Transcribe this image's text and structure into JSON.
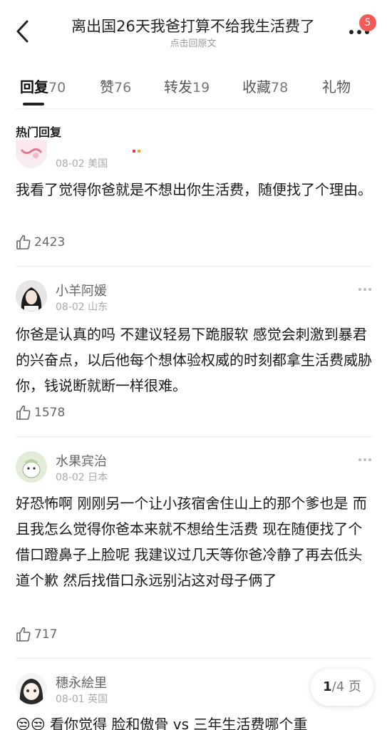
{
  "header": {
    "title": "离出国26天我爸打算不给我生活费了",
    "subtitle": "点击回原文",
    "badge_count": "5"
  },
  "tabs": [
    {
      "label": "回复",
      "count": "70",
      "active": true
    },
    {
      "label": "赞",
      "count": "76",
      "active": false
    },
    {
      "label": "转发",
      "count": "19",
      "active": false
    },
    {
      "label": "收藏",
      "count": "78",
      "active": false
    },
    {
      "label": "礼物",
      "count": "",
      "active": false
    }
  ],
  "section_title": "热门回复",
  "comments": [
    {
      "username": "",
      "date": "08-02",
      "location": "美国",
      "text": "我看了觉得你爸就是不想出你生活费，随便找了个理由。",
      "likes": "2423",
      "avatar": "sticker-avatar"
    },
    {
      "username": "小羊阿媛",
      "date": "08-02",
      "location": "山东",
      "text": "你爸是认真的吗 不建议轻易下跪服软 感觉会刺激到暴君的兴奋点，以后他每个想体验权威的时刻都拿生活费威胁你，钱说断就断一样很难。",
      "likes": "1578",
      "avatar": "girl-photo-avatar"
    },
    {
      "username": "水果宾治",
      "date": "08-02",
      "location": "日本",
      "text": "好恐怖啊 刚刚另一个让小孩宿舍住山上的那个爹也是 而且我怎么觉得你爸本来就不想给生活费 现在随便找了个借口蹬鼻子上脸呢 我建议过几天等你爸冷静了再去低头道个歉 然后找借口永远别沾这对母子俩了",
      "likes": "717",
      "avatar": "cartoon-avatar"
    },
    {
      "username": "穗永絵里",
      "date": "08-01",
      "location": "英国",
      "text": "😒😒 看你觉得 脸和傲骨 vs 三年生活费哪个重",
      "likes": "",
      "avatar": "anime-avatar"
    }
  ],
  "pager": {
    "current": "1",
    "total": "/4",
    "unit": " 页"
  },
  "colors": {
    "badge": "#f25a5a",
    "text": "#1a1a1a",
    "meta": "#aaaaaa",
    "divider": "#eeeeee"
  }
}
